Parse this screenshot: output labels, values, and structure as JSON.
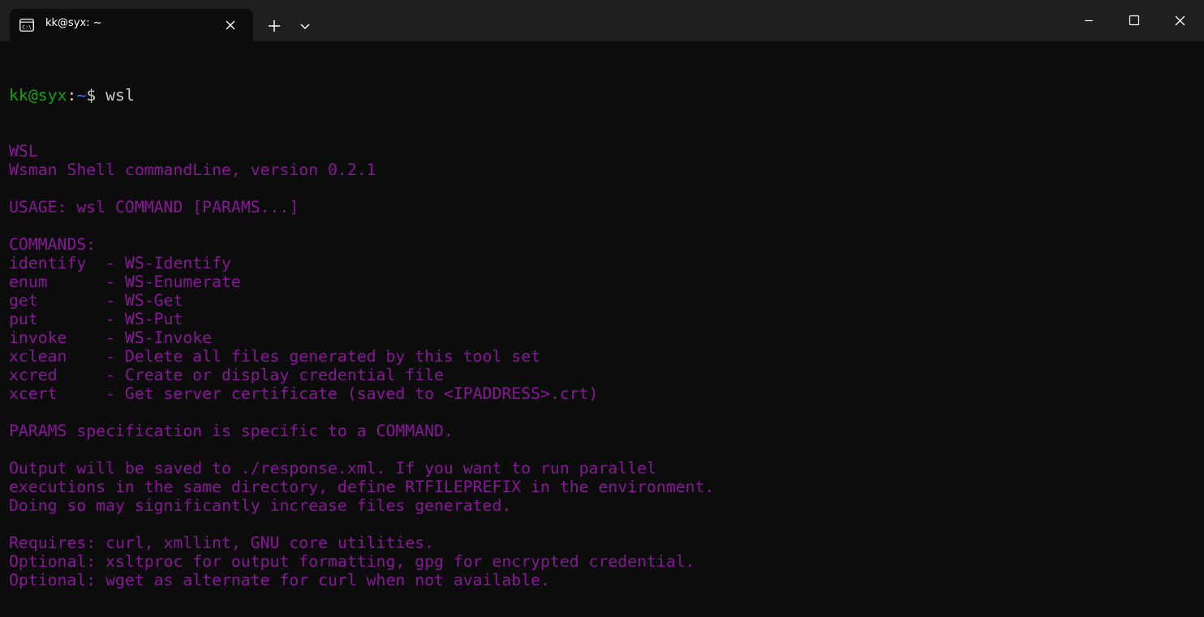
{
  "window": {
    "tab_title": "kk@syx: ~",
    "tab_icon": "terminal-icon",
    "controls": {
      "new_tab": "plus-icon",
      "dropdown": "chevron-down-icon",
      "minimize": "minimize-icon",
      "maximize": "maximize-icon",
      "close": "close-icon"
    }
  },
  "prompt": {
    "user_host": "kk@syx",
    "colon": ":",
    "path": "~",
    "dollar": "$ "
  },
  "terminal": {
    "command": "wsl",
    "output": [
      "WSL",
      "Wsman Shell commandLine, version 0.2.1",
      "",
      "USAGE: wsl COMMAND [PARAMS...]",
      "",
      "COMMANDS:",
      "identify  - WS-Identify",
      "enum      - WS-Enumerate",
      "get       - WS-Get",
      "put       - WS-Put",
      "invoke    - WS-Invoke",
      "xclean    - Delete all files generated by this tool set",
      "xcred     - Create or display credential file",
      "xcert     - Get server certificate (saved to <IPADDRESS>.crt)",
      "",
      "PARAMS specification is specific to a COMMAND.",
      "",
      "Output will be saved to ./response.xml. If you want to run parallel",
      "executions in the same directory, define RTFILEPREFIX in the environment.",
      "Doing so may significantly increase files generated.",
      "",
      "Requires: curl, xmllint, GNU core utilities.",
      "Optional: xsltproc for output formatting, gpg for encrypted credential.",
      "Optional: wget as alternate for curl when not available."
    ]
  },
  "colors": {
    "background": "#0c0c0c",
    "titlebar": "#1f1f1f",
    "prompt_user": "#13a10e",
    "prompt_path": "#3b78ff",
    "output_text": "#881798",
    "foreground": "#cccccc"
  }
}
